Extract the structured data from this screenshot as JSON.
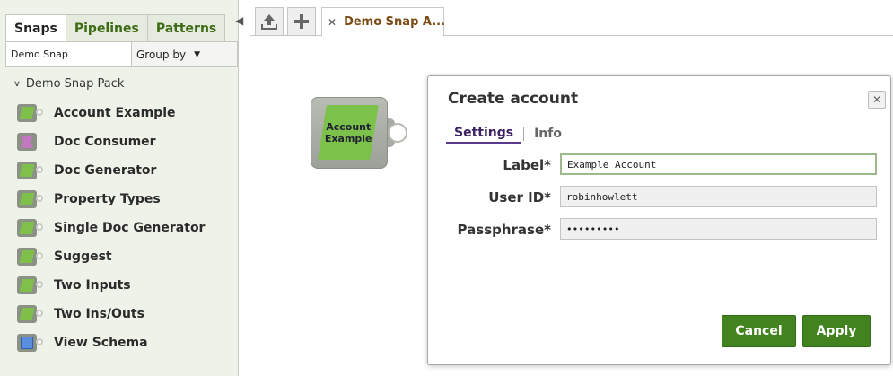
{
  "left_panel": {
    "tabs": [
      {
        "label": "Snaps"
      },
      {
        "label": "Pipelines"
      },
      {
        "label": "Patterns"
      }
    ],
    "search_value": "Demo Snap",
    "groupby_label": "Group by",
    "pack_name": "Demo Snap Pack",
    "snaps": [
      {
        "label": "Account Example",
        "icon": "green-parallelogram-icon"
      },
      {
        "label": "Doc Consumer",
        "icon": "pink-consumer-icon"
      },
      {
        "label": "Doc Generator",
        "icon": "green-parallelogram-icon"
      },
      {
        "label": "Property Types",
        "icon": "green-parallelogram-icon"
      },
      {
        "label": "Single Doc Generator",
        "icon": "green-parallelogram-icon"
      },
      {
        "label": "Suggest",
        "icon": "green-parallelogram-icon"
      },
      {
        "label": "Two Inputs",
        "icon": "green-parallelogram-icon"
      },
      {
        "label": "Two Ins/Outs",
        "icon": "green-parallelogram-icon"
      },
      {
        "label": "View Schema",
        "icon": "blue-square-icon"
      }
    ]
  },
  "toolbar": {
    "upload_icon": "upload-icon",
    "add_icon": "plus-icon",
    "pipeline_tab_label": "Demo Snap A...",
    "close_icon": "close-icon"
  },
  "canvas": {
    "snap_label_line1": "Account",
    "snap_label_line2": "Example"
  },
  "dialog": {
    "title": "Create account",
    "tabs": [
      {
        "label": "Settings"
      },
      {
        "label": "Info"
      }
    ],
    "fields": [
      {
        "label": "Label*",
        "value": "Example Account"
      },
      {
        "label": "User ID*",
        "value": "robinhowlett"
      },
      {
        "label": "Passphrase*",
        "value": "•••••••••"
      }
    ],
    "cancel_label": "Cancel",
    "apply_label": "Apply"
  },
  "colors": {
    "accent_green": "#43831f",
    "tab_green": "#3e6b16",
    "settings_purple": "#5a3a8c",
    "pipeline_tab_brown": "#7b4a12"
  }
}
